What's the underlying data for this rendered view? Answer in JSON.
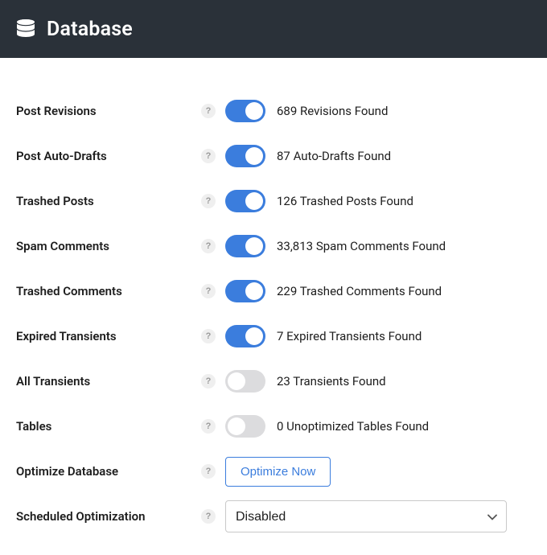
{
  "header": {
    "title": "Database"
  },
  "helpGlyph": "?",
  "rows": {
    "post_revisions": {
      "label": "Post Revisions",
      "value": "689 Revisions Found"
    },
    "post_auto_drafts": {
      "label": "Post Auto-Drafts",
      "value": "87 Auto-Drafts Found"
    },
    "trashed_posts": {
      "label": "Trashed Posts",
      "value": "126 Trashed Posts Found"
    },
    "spam_comments": {
      "label": "Spam Comments",
      "value": "33,813 Spam Comments Found"
    },
    "trashed_comments": {
      "label": "Trashed Comments",
      "value": "229 Trashed Comments Found"
    },
    "expired_transients": {
      "label": "Expired Transients",
      "value": "7 Expired Transients Found"
    },
    "all_transients": {
      "label": "All Transients",
      "value": "23 Transients Found"
    },
    "tables": {
      "label": "Tables",
      "value": "0 Unoptimized Tables Found"
    },
    "optimize_database": {
      "label": "Optimize Database",
      "button": "Optimize Now"
    },
    "scheduled_optimization": {
      "label": "Scheduled Optimization",
      "selected": "Disabled"
    }
  }
}
